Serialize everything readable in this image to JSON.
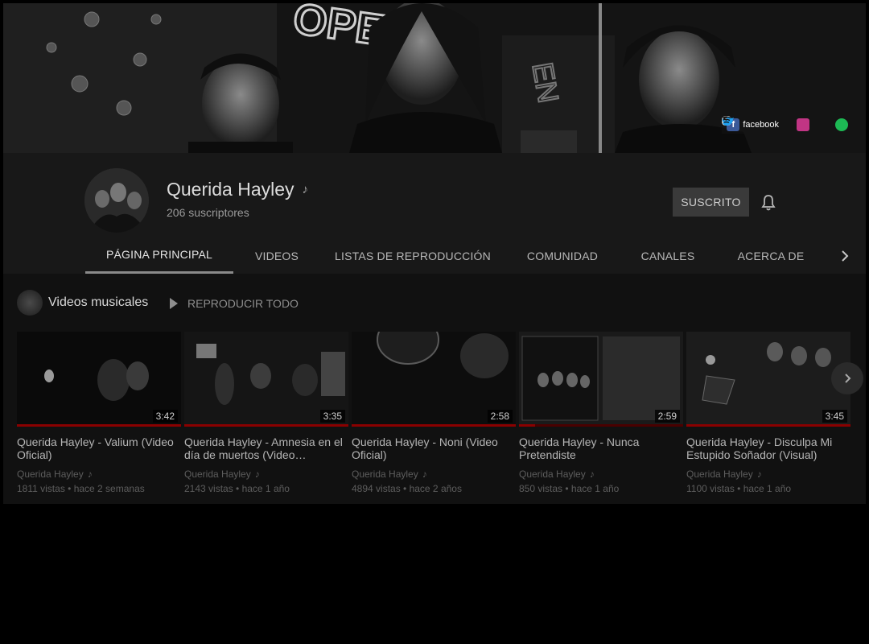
{
  "banner": {
    "social": [
      {
        "name": "facebook",
        "label": "facebook",
        "color": "#3b5998",
        "icon": "facebook-icon"
      },
      {
        "name": "instagram",
        "label": "",
        "color": "#c13584",
        "icon": "instagram-icon"
      },
      {
        "name": "twitter",
        "label": "",
        "color": "#1da1f2",
        "icon": "twitter-icon"
      },
      {
        "name": "spotify",
        "label": "",
        "color": "#1db954",
        "icon": "spotify-icon"
      }
    ]
  },
  "channel": {
    "name": "Querida Hayley",
    "note_icon": "♪",
    "subscribers": "206 suscriptores",
    "subscribe_label": "SUSCRITO"
  },
  "tabs": [
    {
      "label": "PÁGINA PRINCIPAL",
      "active": true
    },
    {
      "label": "VIDEOS",
      "active": false
    },
    {
      "label": "LISTAS DE REPRODUCCIÓN",
      "active": false
    },
    {
      "label": "COMUNIDAD",
      "active": false
    },
    {
      "label": "CANALES",
      "active": false
    },
    {
      "label": "ACERCA DE",
      "active": false
    }
  ],
  "shelf": {
    "title": "Videos musicales",
    "play_all_label": "REPRODUCIR TODO",
    "videos": [
      {
        "title": "Querida Hayley - Valium (Video Oficial)",
        "channel": "Querida Hayley",
        "views": "1811 vistas",
        "age": "hace 2 semanas",
        "duration": "3:42",
        "watched": 1.0
      },
      {
        "title": "Querida Hayley - Amnesia en el día de muertos (Video…",
        "channel": "Querida Hayley",
        "views": "2143 vistas",
        "age": "hace 1 año",
        "duration": "3:35",
        "watched": 1.0
      },
      {
        "title": "Querida Hayley - Noni (Video Oficial)",
        "channel": "Querida Hayley",
        "views": "4894 vistas",
        "age": "hace 2 años",
        "duration": "2:58",
        "watched": 1.0
      },
      {
        "title": "Querida Hayley - Nunca Pretendiste",
        "channel": "Querida Hayley",
        "views": "850 vistas",
        "age": "hace 1 año",
        "duration": "2:59",
        "watched": 0.1
      },
      {
        "title": "Querida Hayley - Disculpa Mi Estupido Soñador (Visual)",
        "channel": "Querida Hayley",
        "views": "1100 vistas",
        "age": "hace 1 año",
        "duration": "3:45",
        "watched": 1.0
      }
    ]
  }
}
